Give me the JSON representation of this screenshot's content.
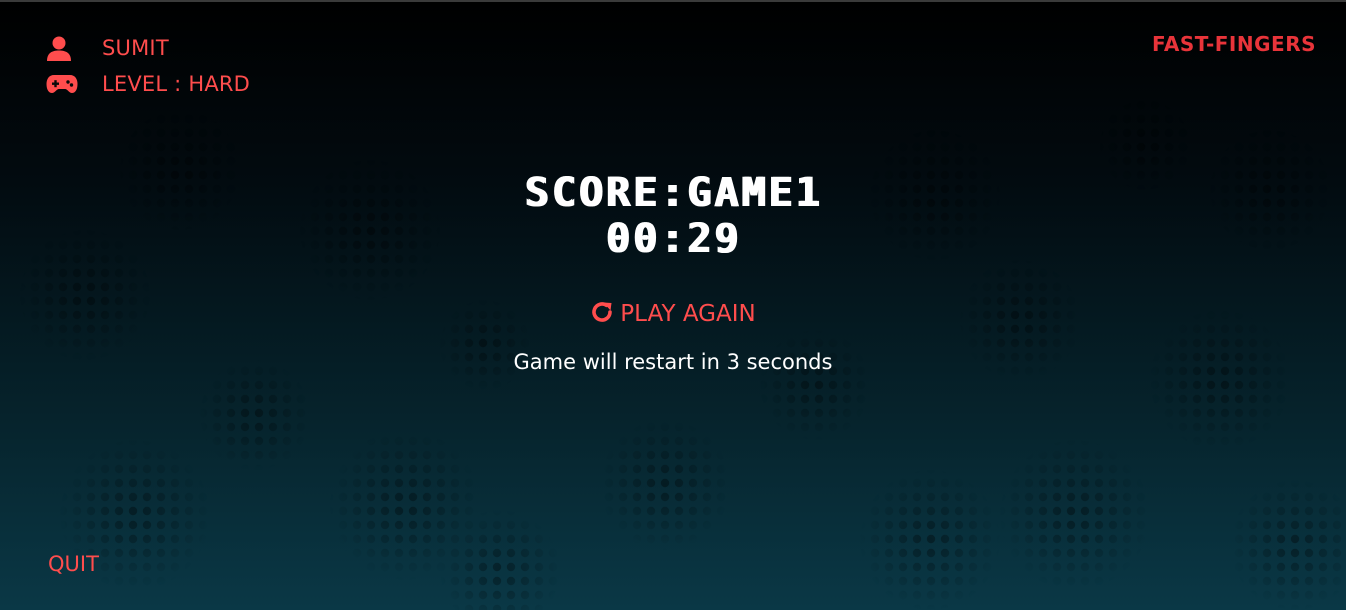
{
  "player": {
    "name": "SUMIT",
    "level": "LEVEL : HARD",
    "user_icon": "user-icon",
    "level_icon": "gamepad-icon"
  },
  "brand": {
    "title": "FAST-FINGERS"
  },
  "result": {
    "score_label": "SCORE:GAME1",
    "time": "00:29",
    "play_again_label": "PLAY AGAIN",
    "play_again_icon": "redo-icon",
    "restart_message": "Game will restart in 3 seconds"
  },
  "footer": {
    "quit_label": "QUIT"
  },
  "colors": {
    "accent": "#ff4d4d",
    "brand": "#e8343a",
    "text": "#ffffff",
    "background_top": "#000000",
    "background_bottom": "#0a3846"
  }
}
